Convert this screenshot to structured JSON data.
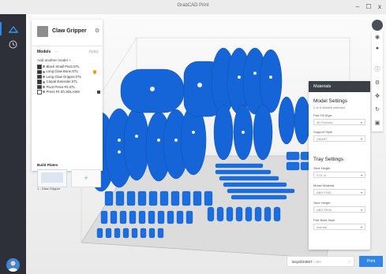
{
  "window": {
    "title": "GrabCAD Print",
    "controls": [
      "–",
      "☐",
      "x"
    ]
  },
  "project": {
    "name": "Claw Gripper",
    "models_heading": "Models",
    "models_count": "—",
    "apply_label": "Apply",
    "add_model": "Add another model  +",
    "models": [
      {
        "name": "Black Small Pivot.STL",
        "checked": true,
        "warning": false,
        "tick": false
      },
      {
        "name": "Long Claw Bone.STL",
        "checked": true,
        "warning": true,
        "tick": false
      },
      {
        "name": "Long Claw Gripper.STL",
        "checked": true,
        "warning": false,
        "tick": false
      },
      {
        "name": "Carpal Extender.STL",
        "checked": true,
        "warning": false,
        "tick": false
      },
      {
        "name": "Pivot Press-Fit.STL",
        "checked": true,
        "warning": false,
        "tick": false
      },
      {
        "name": "Press Fit Sh.SDLASM",
        "checked": false,
        "warning": false,
        "tick": true
      }
    ],
    "build_plates_heading": "Build Plates",
    "build_plate_label": "1 - Claw Gripper",
    "add_plate": "+"
  },
  "materials": {
    "header": "Materials",
    "model_settings_title": "Model Settings",
    "model_settings_sub": "2 of 6 Models selected",
    "part_fill_label": "Part Fill Style",
    "part_fill_value": "3D Preview",
    "support_label": "Support Style",
    "support_value": "SMART",
    "tray_title": "Tray Settings",
    "slice_height_label": "Slice Height",
    "slice_height_value": "0.01 in",
    "model_material_label": "Model Material",
    "model_material_value": "ABS P430",
    "slice_height2_label": "Slice Height",
    "slice_height2_value": "ABS SR30",
    "build_style_label": "Part Build Style",
    "build_style_value": "Normal"
  },
  "bottom": {
    "printer": "lasyd234567",
    "status": "Idle",
    "print_label": "Print"
  },
  "colors": {
    "accent": "#2f86e8",
    "parts": "#1565d8",
    "sidebar": "#2d3038"
  }
}
